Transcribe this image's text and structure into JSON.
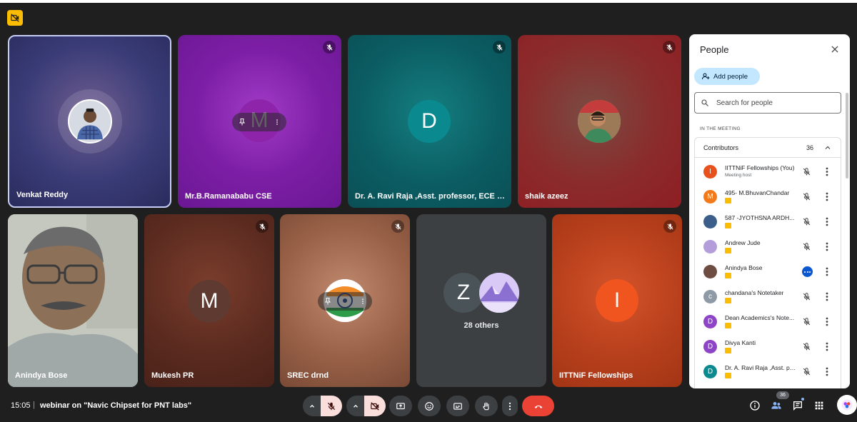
{
  "meeting": {
    "time": "15:05",
    "separator": "|",
    "title": "webinar on \"Navic Chipset for PNT labs\""
  },
  "tiles": [
    {
      "name": "Venkat Reddy",
      "muted": false,
      "speaking": true
    },
    {
      "name": "Mr.B.Ramanababu CSE",
      "initial": "M",
      "muted": true
    },
    {
      "name": "Dr. A. Ravi Raja ,Asst. professor, ECE Depar...",
      "initial": "D",
      "muted": true
    },
    {
      "name": "shaik azeez",
      "muted": true
    },
    {
      "name": "Anindya Bose",
      "muted": false
    },
    {
      "name": "Mukesh PR",
      "initial": "M",
      "muted": true
    },
    {
      "name": "SREC drnd",
      "muted": true
    },
    {
      "name": "",
      "initial": "Z",
      "others_label": "28 others"
    },
    {
      "name": "IITTNiF Fellowships",
      "initial": "I",
      "muted": true
    }
  ],
  "panel": {
    "title": "People",
    "add_people_label": "Add people",
    "search_placeholder": "Search for people",
    "section_label": "IN THE MEETING",
    "contributors_label": "Contributors",
    "contributors_count": "36",
    "participants": [
      {
        "initial": "I",
        "color": "#e8501c",
        "name": "IITTNiF Fellowships (You)",
        "subtitle": "Meeting host",
        "status": "muted"
      },
      {
        "initial": "M",
        "color": "#f27a1a",
        "name": "495- M.BhuvanChandar",
        "status": "muted"
      },
      {
        "initial": "",
        "color": "#3b5f8a",
        "name": "587 -JYOTHSNA ARDH...",
        "status": "muted"
      },
      {
        "initial": "",
        "color": "#b39ddb",
        "name": "Andrew Jude",
        "status": "muted"
      },
      {
        "initial": "",
        "color": "#6d4c41",
        "name": "Anindya Bose",
        "status": "active"
      },
      {
        "initial": "c",
        "color": "#8e9aa6",
        "name": "chandana's Notetaker",
        "status": "muted"
      },
      {
        "initial": "D",
        "color": "#8e44c7",
        "name": "Dean Academics's Note...",
        "status": "muted"
      },
      {
        "initial": "D",
        "color": "#8e44c7",
        "name": "Divya Kanti",
        "status": "muted"
      },
      {
        "initial": "D",
        "color": "#0a8a8f",
        "name": "Dr. A. Ravi Raja ,Asst. pr...",
        "status": "muted"
      }
    ]
  },
  "toolbar": {
    "people_count": "36"
  },
  "colors": {
    "background": "#1f1f1f",
    "end_call": "#ea4335",
    "muted_control": "#f9dedc",
    "accent": "#0b57d0"
  }
}
